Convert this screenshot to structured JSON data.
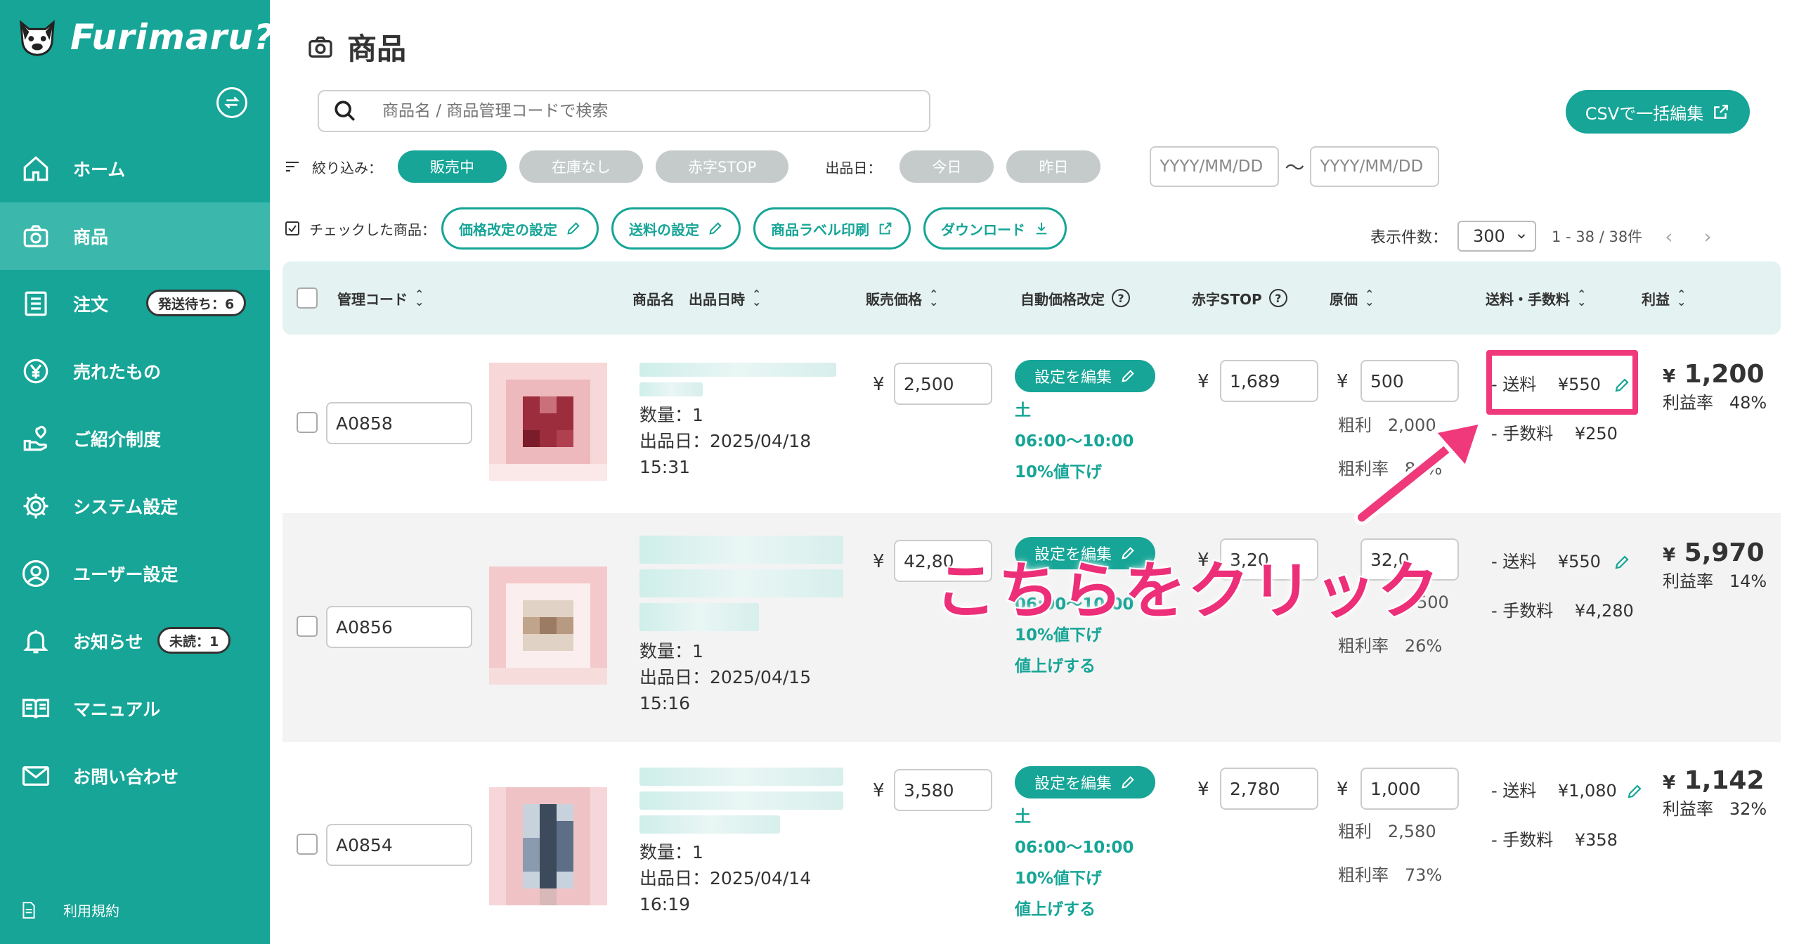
{
  "app": {
    "name": "Furimaru?"
  },
  "sidebar": {
    "items": [
      {
        "label": "ホーム",
        "icon": "home-icon"
      },
      {
        "label": "商品",
        "icon": "camera-icon",
        "active": true
      },
      {
        "label": "注文",
        "icon": "list-icon",
        "badge": "発送待ち：6"
      },
      {
        "label": "売れたもの",
        "icon": "yen-icon"
      },
      {
        "label": "ご紹介制度",
        "icon": "referral-icon"
      },
      {
        "label": "システム設定",
        "icon": "gear-icon"
      },
      {
        "label": "ユーザー設定",
        "icon": "user-icon"
      },
      {
        "label": "お知らせ",
        "icon": "bell-icon",
        "badge": "未読：1"
      },
      {
        "label": "マニュアル",
        "icon": "book-icon"
      },
      {
        "label": "お問い合わせ",
        "icon": "mail-icon"
      }
    ],
    "terms": "利用規約"
  },
  "page": {
    "title": "商品"
  },
  "search": {
    "placeholder": "商品名 / 商品管理コードで検索"
  },
  "csv_button": "CSVで一括編集",
  "filters": {
    "label": "絞り込み：",
    "chips": [
      "販売中",
      "在庫なし",
      "赤字STOP"
    ],
    "date_label": "出品日：",
    "date_chips": [
      "今日",
      "昨日"
    ],
    "date_from_placeholder": "YYYY/MM/DD",
    "date_to_placeholder": "YYYY/MM/DD",
    "tilde": "〜"
  },
  "actions": {
    "checked_label": "チェックした商品：",
    "buttons": [
      "価格改定の設定",
      "送料の設定",
      "商品ラベル印刷",
      "ダウンロード"
    ]
  },
  "pager": {
    "per_page_label": "表示件数：",
    "per_page": "300",
    "range": "1 - 38 / 38件"
  },
  "columns": {
    "code": "管理コード",
    "name": "商品名",
    "listed": "出品日時",
    "price": "販売価格",
    "auto": "自動価格改定",
    "stop": "赤字STOP",
    "cost": "原価",
    "fee": "送料・手数料",
    "profit": "利益"
  },
  "labels": {
    "qty": "数量：1",
    "listed_prefix": "出品日：",
    "edit_btn": "設定を編集",
    "gross": "粗利",
    "gross_rate": "粗利率",
    "shipping": "- 送料",
    "commission": "- 手数料",
    "profit_rate": "利益率",
    "yen": "¥"
  },
  "rows": [
    {
      "code": "A0858",
      "date": "2025/04/18",
      "time": "15:31",
      "price": "2,500",
      "auto_day": "土",
      "auto_time": "06:00〜10:00",
      "auto_rule": "10%値下げ",
      "auto_extra": "",
      "stop": "1,689",
      "cost": "500",
      "gross": "2,000",
      "gross_rate": "80%",
      "shipping": "¥550",
      "commission": "¥250",
      "profit": "1,200",
      "profit_rate": "48%"
    },
    {
      "code": "A0856",
      "date": "2025/04/15",
      "time": "15:16",
      "price": "42,80",
      "auto_day": "",
      "auto_time": "06:00〜10:00",
      "auto_rule": "10%値下げ",
      "auto_extra": "値上げする",
      "stop": "3,20",
      "cost": "32,0",
      "gross": "",
      "gross_rate": "26%",
      "gross_partial": "500",
      "shipping": "¥550",
      "commission": "¥4,280",
      "profit": "5,970",
      "profit_rate": "14%"
    },
    {
      "code": "A0854",
      "date": "2025/04/14",
      "time": "16:19",
      "price": "3,580",
      "auto_day": "土",
      "auto_time": "06:00〜10:00",
      "auto_rule": "10%値下げ",
      "auto_extra": "値上げする",
      "stop": "2,780",
      "cost": "1,000",
      "gross": "2,580",
      "gross_rate": "73%",
      "shipping": "¥1,080",
      "commission": "¥358",
      "profit": "1,142",
      "profit_rate": "32%"
    }
  ],
  "annotation": {
    "text": "こちらをクリック"
  },
  "colors": {
    "brand": "#16a597",
    "accent": "#ec2f78",
    "header_bg": "#e4f3f1"
  }
}
